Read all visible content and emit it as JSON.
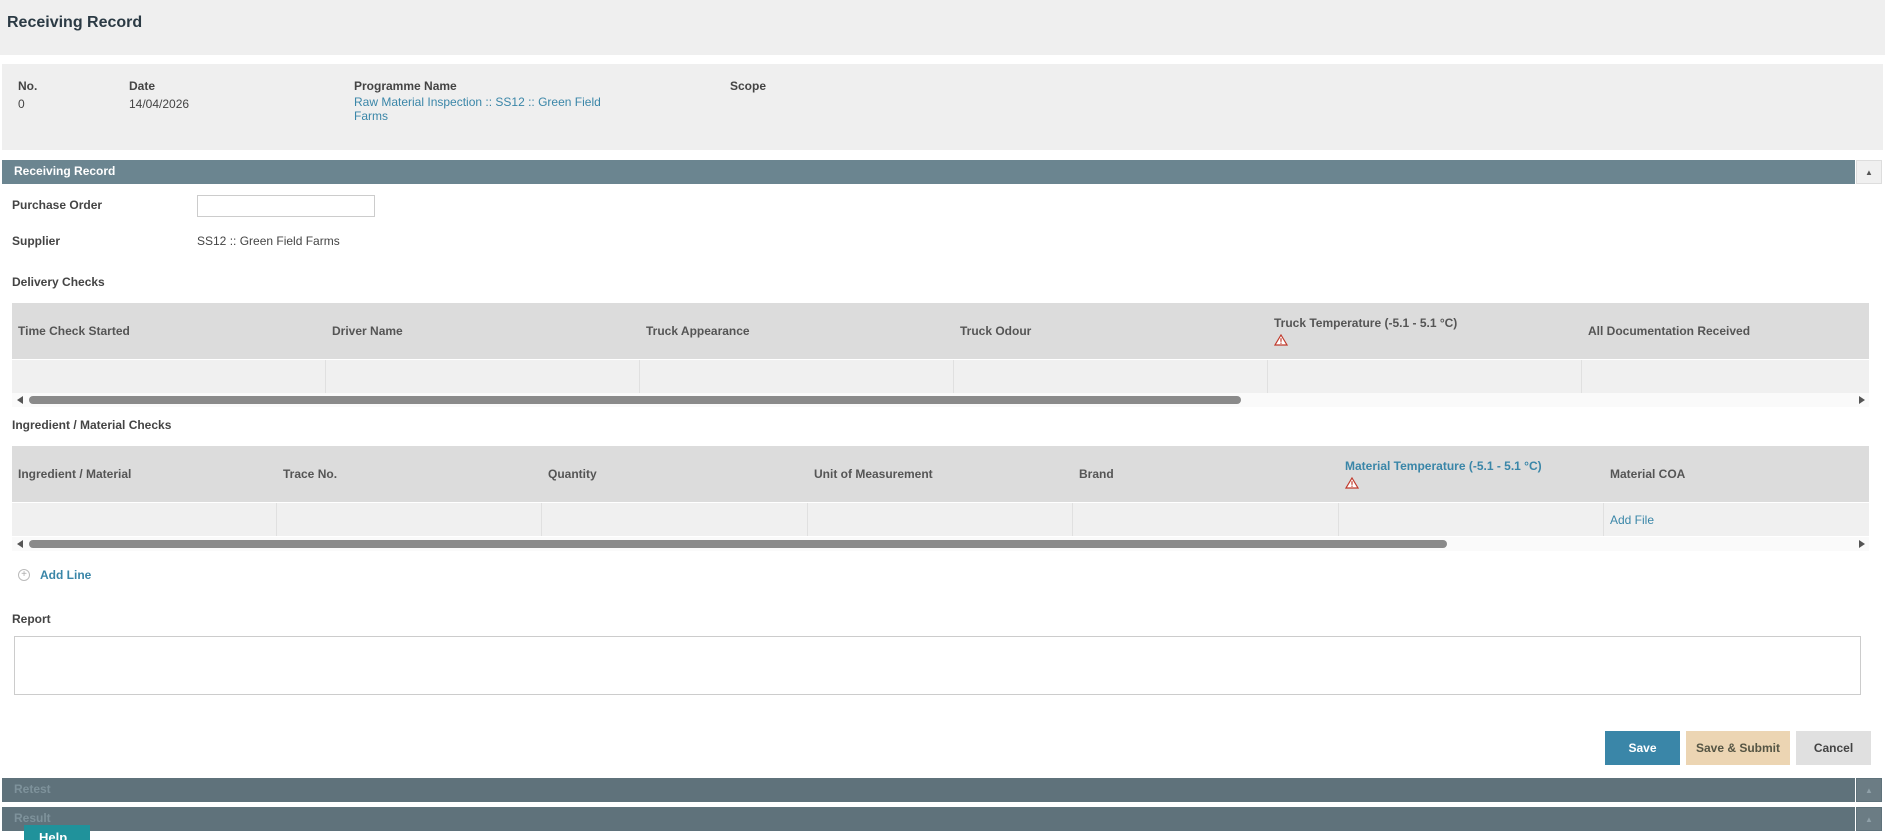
{
  "page": {
    "title": "Receiving Record"
  },
  "info": {
    "number_label": "No.",
    "number_value": "0",
    "date_label": "Date",
    "date_value": "14/04/2026",
    "programme_label": "Programme Name",
    "programme_value_line1": "Raw Material Inspection :: SS12 :: Green Field",
    "programme_value_line2": "Farms",
    "scope_label": "Scope"
  },
  "receiving_section": {
    "title": "Receiving Record"
  },
  "form": {
    "purchase_order_label": "Purchase Order",
    "purchase_order_value": "",
    "supplier_label": "Supplier",
    "supplier_value": "SS12 :: Green Field Farms",
    "delivery_checks_label": "Delivery Checks",
    "ingredient_checks_label": "Ingredient / Material Checks",
    "report_label": "Report",
    "report_value": ""
  },
  "delivery_table": {
    "columns": [
      "Time Check Started",
      "Driver Name",
      "Truck Appearance",
      "Truck Odour",
      "Truck Temperature (-5.1 - 5.1 °C)",
      "All Documentation Received"
    ],
    "rows": [
      [
        "",
        "",
        "",
        "",
        "",
        ""
      ]
    ]
  },
  "ingredient_table": {
    "columns": [
      "Ingredient / Material",
      "Trace No.",
      "Quantity",
      "Unit of Measurement",
      "Brand",
      "Material Temperature (-5.1 - 5.1 °C)",
      "Material COA"
    ],
    "rows": [
      [
        "",
        "",
        "",
        "",
        "",
        "",
        ""
      ]
    ],
    "add_file_label": "Add File"
  },
  "add_line_label": "Add Line",
  "buttons": {
    "save": "Save",
    "save_submit": "Save & Submit",
    "cancel": "Cancel"
  },
  "collapsed_sections": {
    "retest": "Retest",
    "result": "Result"
  },
  "help_label": "Help",
  "colors": {
    "accent": "#3a86a8",
    "section_bar": "#6b8590",
    "submit": "#ecd5b3",
    "warning": "#c0392b"
  },
  "icons": {
    "collapse": "caret-up-icon",
    "warning": "warning-icon",
    "add": "plus-circle-icon"
  }
}
